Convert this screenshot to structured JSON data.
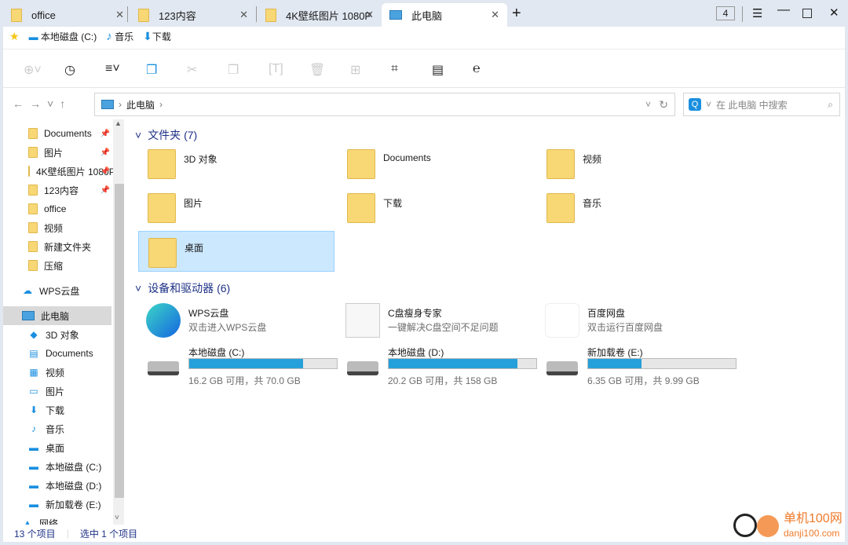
{
  "tabs": [
    {
      "label": "office",
      "icon": "folder-icon"
    },
    {
      "label": "123内容",
      "icon": "folder-icon"
    },
    {
      "label": "4K壁纸图片 1080P",
      "icon": "folder-icon"
    },
    {
      "label": "此电脑",
      "icon": "computer-icon",
      "active": true
    }
  ],
  "window": {
    "tab_count": "4"
  },
  "favorites": [
    {
      "label": "本地磁盘 (C:)"
    },
    {
      "label": "音乐"
    },
    {
      "label": "下载"
    }
  ],
  "address": {
    "path": "此电脑",
    "search_placeholder": "在 此电脑 中搜索"
  },
  "sidebar": {
    "quick": [
      {
        "label": "Documents",
        "pin": true
      },
      {
        "label": "图片",
        "pin": true
      },
      {
        "label": "4K壁纸图片 1080P",
        "pin": true
      },
      {
        "label": "123内容",
        "pin": true
      },
      {
        "label": "office"
      },
      {
        "label": "视频"
      },
      {
        "label": "新建文件夹"
      },
      {
        "label": "压缩"
      }
    ],
    "wps": "WPS云盘",
    "pc": "此电脑",
    "pc_items": [
      {
        "label": "3D 对象"
      },
      {
        "label": "Documents"
      },
      {
        "label": "视频"
      },
      {
        "label": "图片"
      },
      {
        "label": "下载"
      },
      {
        "label": "音乐"
      },
      {
        "label": "桌面"
      },
      {
        "label": "本地磁盘 (C:)"
      },
      {
        "label": "本地磁盘 (D:)"
      },
      {
        "label": "新加载卷 (E:)"
      }
    ],
    "network": "网络"
  },
  "folders": {
    "title": "文件夹 (7)",
    "items": [
      {
        "label": "3D 对象"
      },
      {
        "label": "Documents"
      },
      {
        "label": "视频"
      },
      {
        "label": "图片"
      },
      {
        "label": "下载"
      },
      {
        "label": "音乐"
      },
      {
        "label": "桌面",
        "selected": true
      }
    ]
  },
  "devices": {
    "title": "设备和驱动器 (6)",
    "apps": [
      {
        "name": "WPS云盘",
        "desc": "双击进入WPS云盘"
      },
      {
        "name": "C盘瘦身专家",
        "desc": "一键解决C盘空间不足问题"
      },
      {
        "name": "百度网盘",
        "desc": "双击运行百度网盘"
      }
    ],
    "drives": [
      {
        "name": "本地磁盘 (C:)",
        "info": "16.2 GB 可用，共 70.0 GB",
        "used_fraction": 0.769
      },
      {
        "name": "本地磁盘 (D:)",
        "info": "20.2 GB 可用，共 158 GB",
        "used_fraction": 0.872
      },
      {
        "name": "新加载卷 (E:)",
        "info": "6.35 GB 可用，共 9.99 GB",
        "used_fraction": 0.364
      }
    ]
  },
  "status": {
    "count": "13 个项目",
    "selected": "选中 1 个项目"
  },
  "watermark": "单机100网 danji100.com",
  "colors": {
    "accent": "#26a0da",
    "selection": "#cce8ff"
  }
}
